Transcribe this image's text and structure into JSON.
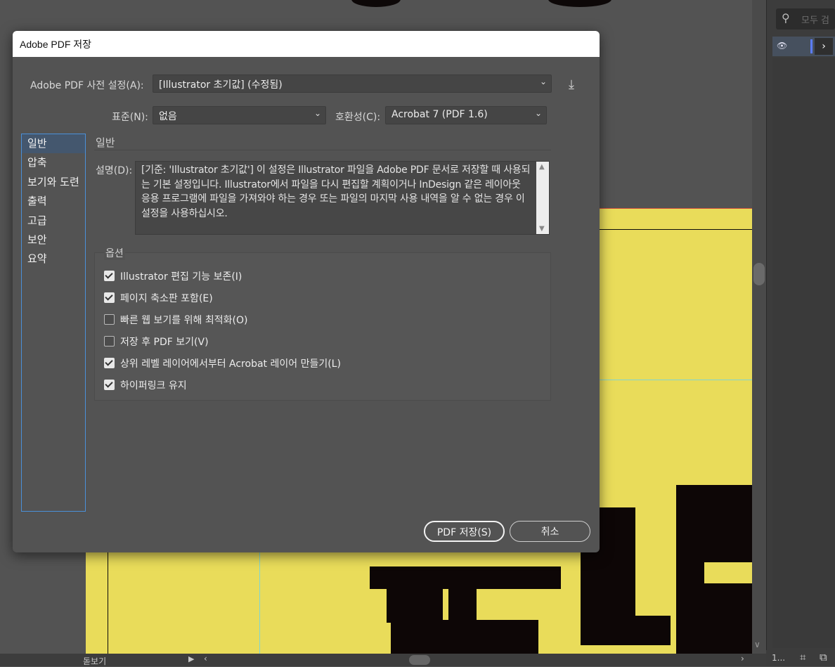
{
  "dialog": {
    "title": "Adobe PDF 저장",
    "preset_label": "Adobe PDF 사전 설정(A):",
    "preset_value": "[Illustrator 초기값] (수정됨)",
    "standard_label": "표준(N):",
    "standard_value": "없음",
    "compat_label": "호환성(C):",
    "compat_value": "Acrobat 7 (PDF 1.6)",
    "nav_items": [
      "일반",
      "압축",
      "보기와 도련",
      "출력",
      "고급",
      "보안",
      "요약"
    ],
    "section_title": "일반",
    "description_label": "설명(D):",
    "description_text": "[기준: 'Illustrator 초기값'] 이 설정은 Illustrator 파일을 Adobe PDF 문서로 저장할 때 사용되는 기본 설정입니다. Illustrator에서 파일을 다시 편집할 계획이거나 InDesign 같은 레이아웃 응용 프로그램에 파일을 가져와야 하는 경우 또는 파일의 마지막 사용 내역을 알 수 없는 경우 이 설정을 사용하십시오.",
    "options_title": "옵션",
    "options": [
      {
        "label": "Illustrator 편집 기능 보존(I)",
        "checked": true
      },
      {
        "label": "페이지 축소판 포함(E)",
        "checked": true
      },
      {
        "label": "빠른 웹 보기를 위해 최적화(O)",
        "checked": false
      },
      {
        "label": "저장 후 PDF 보기(V)",
        "checked": false
      },
      {
        "label": "상위 레벨 레이어에서부터 Acrobat 레이어 만들기(L)",
        "checked": true
      },
      {
        "label": "하이퍼링크 유지",
        "checked": true
      }
    ],
    "save_button": "PDF 저장(S)",
    "cancel_button": "취소"
  },
  "panel": {
    "search_placeholder": "모두 검",
    "layer_count": "1..."
  },
  "statusbar": {
    "zoom_label": "돋보기"
  },
  "colors": {
    "artboard": "#e9dc5a",
    "nav_border": "#4a90d9",
    "layer_color": "#5c7dff"
  }
}
